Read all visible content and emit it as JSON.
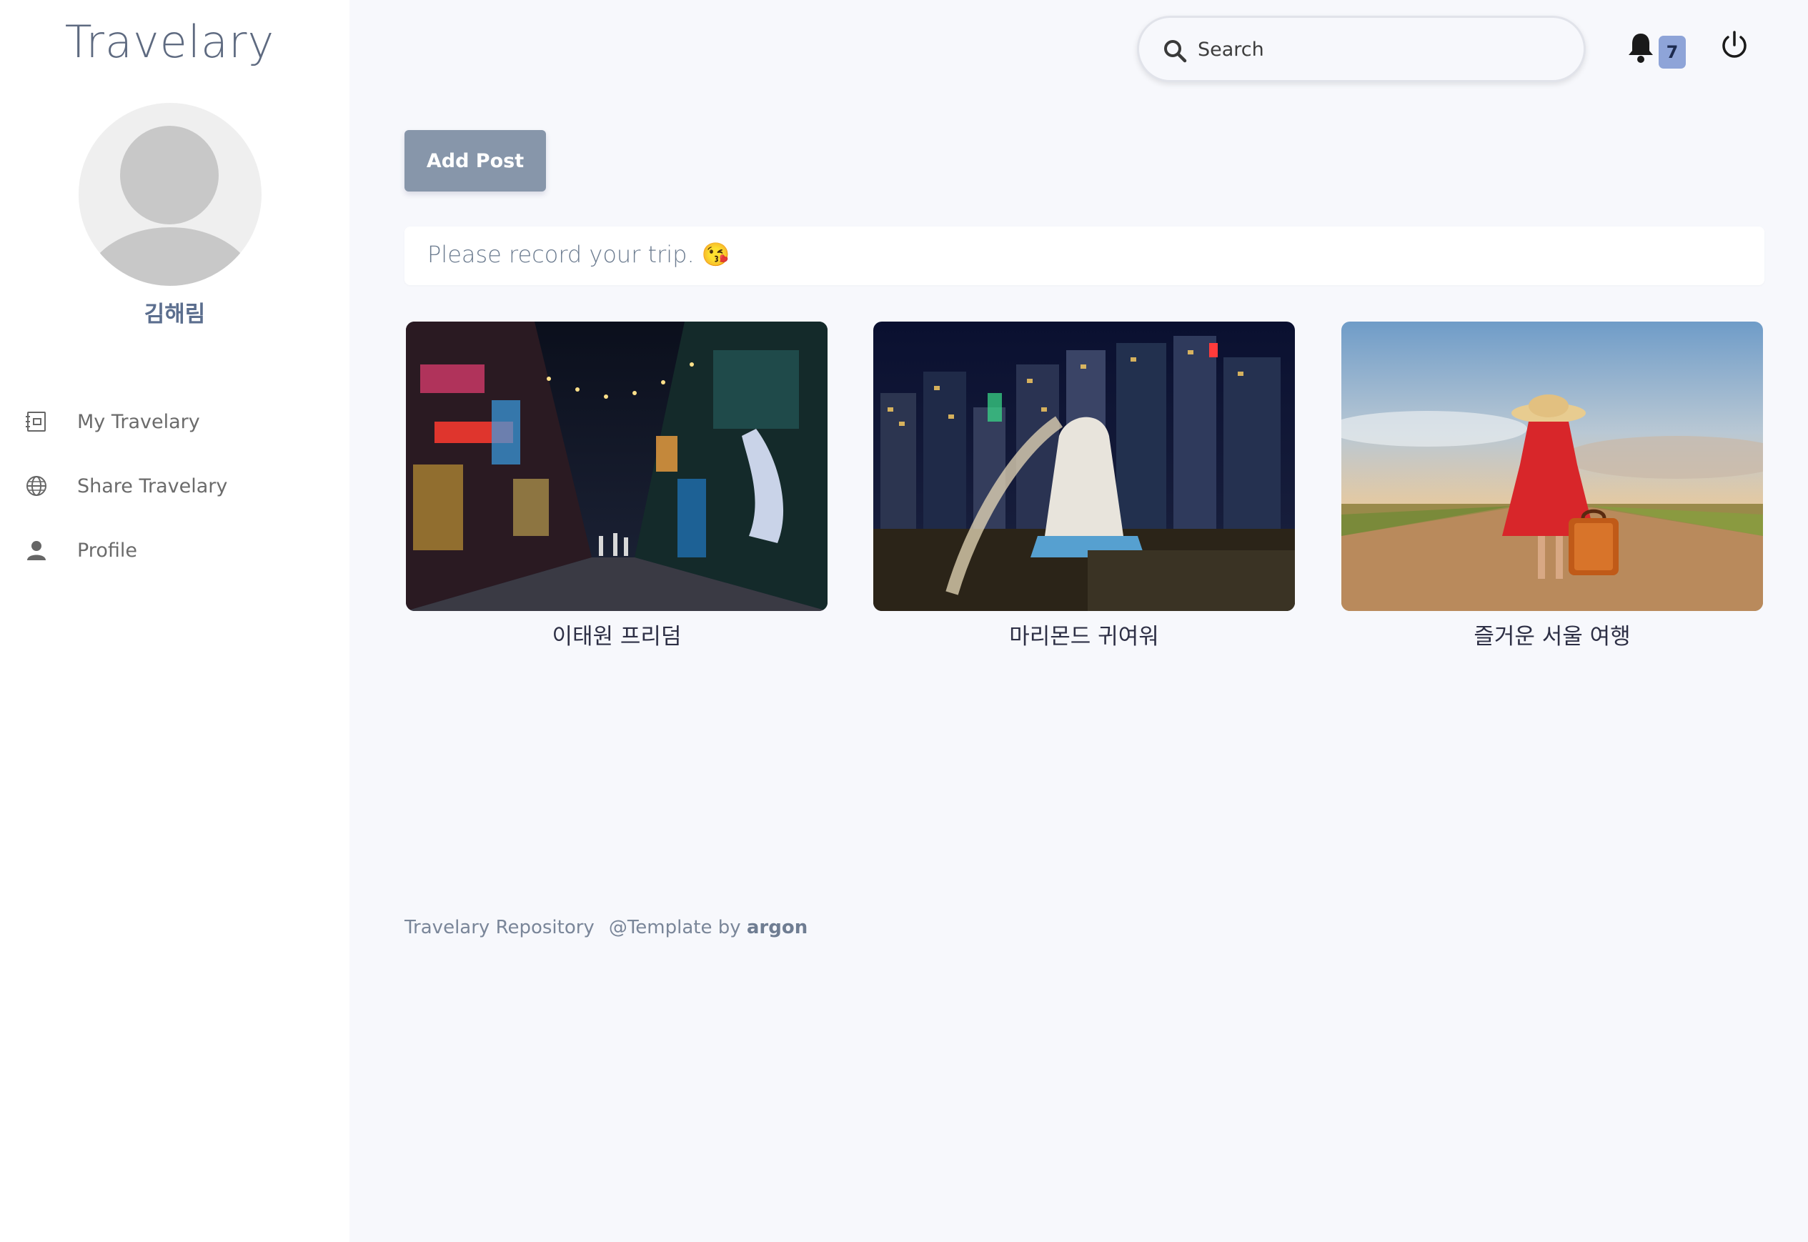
{
  "app": {
    "title": "Travelary"
  },
  "user": {
    "name": "김해림"
  },
  "sidebar": {
    "items": [
      {
        "label": "My Travelary",
        "icon": "notebook-icon"
      },
      {
        "label": "Share Travelary",
        "icon": "globe-icon"
      },
      {
        "label": "Profile",
        "icon": "user-icon"
      }
    ]
  },
  "topbar": {
    "search_placeholder": "Search",
    "notification_count": "7"
  },
  "main": {
    "add_post_label": "Add Post",
    "trip_prompt": "Please record your trip. 😘",
    "posts": [
      {
        "title": "이태원 프리덤"
      },
      {
        "title": "마리몬드 귀여워"
      },
      {
        "title": "즐거운 서울 여행"
      }
    ]
  },
  "footer": {
    "repo_text": "Travelary Repository",
    "template_text": "@Template by",
    "template_brand": "argon"
  }
}
